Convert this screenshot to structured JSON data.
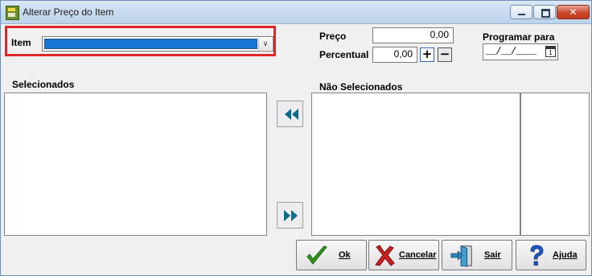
{
  "window": {
    "title": "Alterar Preço do Item",
    "icon": "app-icon",
    "controls": {
      "minimize": "minimize-icon",
      "maximize": "maximize-icon",
      "close": "✕"
    }
  },
  "item": {
    "label": "Item",
    "selected_value": ""
  },
  "preco": {
    "label": "Preço",
    "value": "0,00"
  },
  "percentual": {
    "label": "Percentual",
    "value": "0,00",
    "plus": "+",
    "minus": "−"
  },
  "programar": {
    "label": "Programar para",
    "value": "__/__/____",
    "calendar_day": "1"
  },
  "lists": {
    "selecionados_label": "Selecionados",
    "nao_selecionados_label": "Não Selecionados",
    "move_left_icon": "double-left-arrow-icon",
    "move_right_icon": "double-right-arrow-icon"
  },
  "buttons": {
    "ok": "Ok",
    "cancelar": "Cancelar",
    "sair": "Sair",
    "ajuda": "Ajuda"
  },
  "colors": {
    "accent_red_frame": "#e02828",
    "selection_blue": "#1874d5",
    "arrow_teal": "#0d6b8c",
    "ok_green": "#2f9a1a",
    "cancel_red": "#c8201f",
    "help_blue": "#1f57c9"
  }
}
